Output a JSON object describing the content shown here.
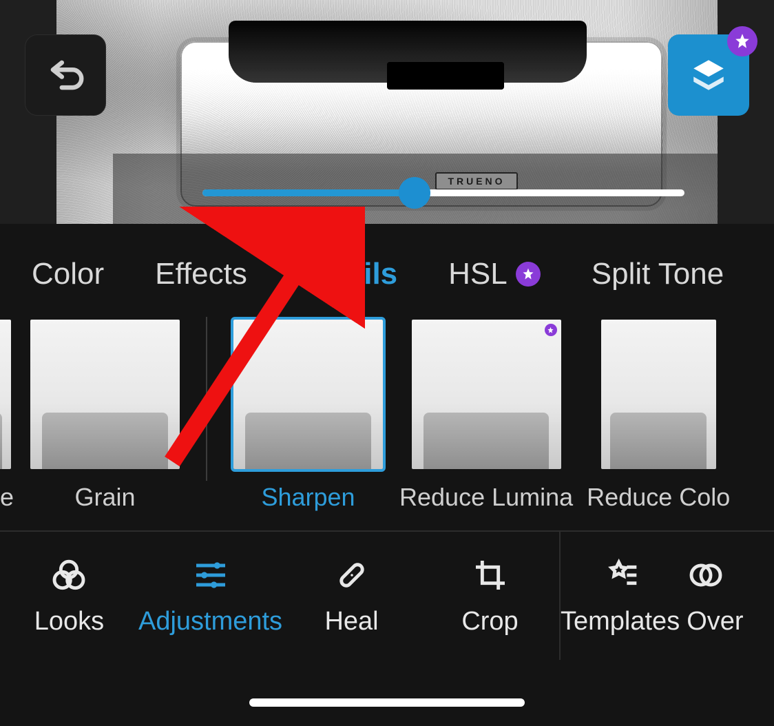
{
  "colors": {
    "accent": "#2e9ddb",
    "premium": "#8a3bd8",
    "bg": "#141414"
  },
  "stage": {
    "plate_text": "TRUENO",
    "slider": {
      "percent": 44
    }
  },
  "buttons": {
    "undo_name": "undo-icon",
    "layers_name": "layers-icon",
    "star_name": "star-icon"
  },
  "tabs": [
    {
      "label": "Color",
      "active": false,
      "premium": false
    },
    {
      "label": "Effects",
      "active": false,
      "premium": false
    },
    {
      "label": "Details",
      "active": true,
      "premium": false
    },
    {
      "label": "HSL",
      "active": false,
      "premium": true
    },
    {
      "label": "Split Tone",
      "active": false,
      "premium": false
    }
  ],
  "thumbs": {
    "left_group": [
      {
        "id": "fade",
        "label": "de",
        "partial": true
      },
      {
        "id": "grain",
        "label": "Grain",
        "partial": false
      }
    ],
    "right_group": [
      {
        "id": "sharpen",
        "label": "Sharpen",
        "active": true,
        "premium": false
      },
      {
        "id": "reduce_luma",
        "label": "Reduce Lumina",
        "active": false,
        "premium": true
      },
      {
        "id": "reduce_color",
        "label": "Reduce Colo",
        "active": false,
        "premium": false,
        "partial": true
      }
    ]
  },
  "toolbar": [
    {
      "id": "looks",
      "label": "Looks",
      "active": false
    },
    {
      "id": "adjustments",
      "label": "Adjustments",
      "active": true
    },
    {
      "id": "heal",
      "label": "Heal",
      "active": false
    },
    {
      "id": "crop",
      "label": "Crop",
      "active": false
    },
    {
      "id": "templates",
      "label": "Templates",
      "active": false,
      "section": "right"
    },
    {
      "id": "overlays",
      "label": "Over",
      "active": false,
      "section": "right",
      "partial": true
    }
  ]
}
